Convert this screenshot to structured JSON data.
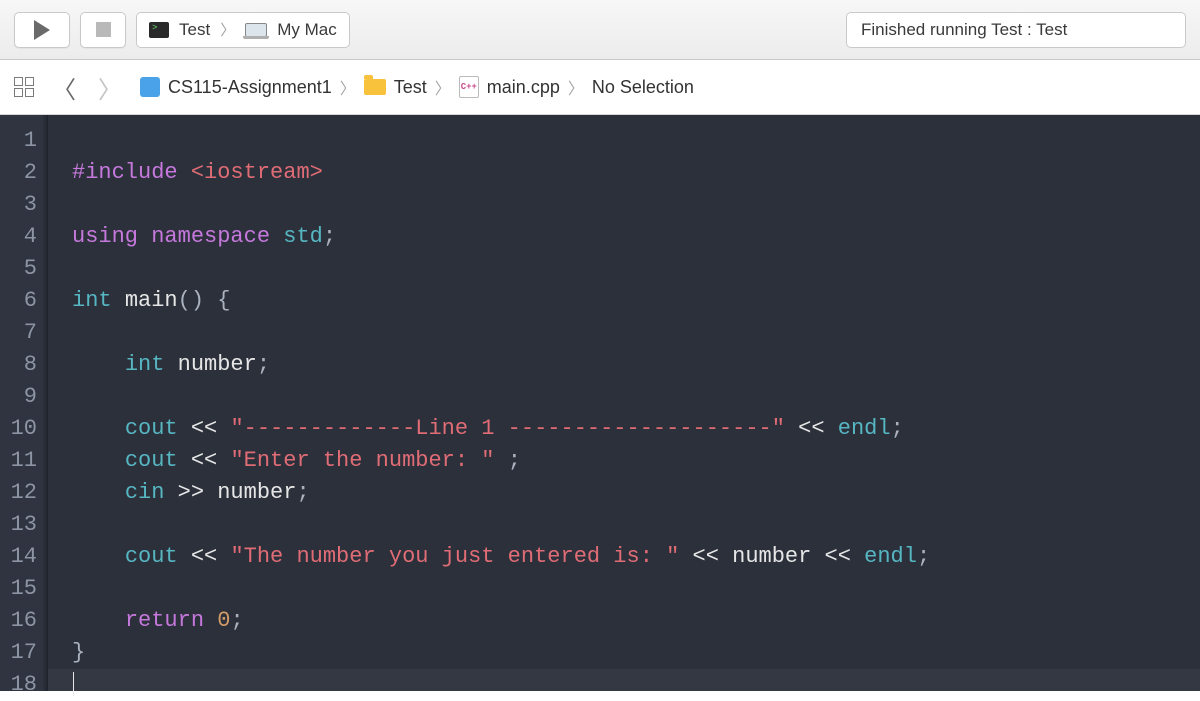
{
  "toolbar": {
    "scheme_target": "Test",
    "scheme_device": "My Mac",
    "activity_text": "Finished running Test : Test"
  },
  "breadcrumb": {
    "project": "CS115-Assignment1",
    "folder": "Test",
    "file": "main.cpp",
    "selection": "No Selection"
  },
  "code": {
    "line_numbers": [
      "1",
      "2",
      "3",
      "4",
      "5",
      "6",
      "7",
      "8",
      "9",
      "10",
      "11",
      "12",
      "13",
      "14",
      "15",
      "16",
      "17",
      "18"
    ],
    "l2_include": "#include",
    "l2_header": "<iostream>",
    "l4_using": "using",
    "l4_namespace": "namespace",
    "l4_std": "std",
    "l6_int": "int",
    "l6_main": "main",
    "l8_int": "int",
    "l8_number": "number",
    "l10_cout": "cout",
    "l10_str": "\"-------------Line 1 --------------------\"",
    "l10_endl": "endl",
    "l11_cout": "cout",
    "l11_str": "\"Enter the number: \"",
    "l12_cin": "cin",
    "l12_number": "number",
    "l14_cout": "cout",
    "l14_str": "\"The number you just entered is: \"",
    "l14_number": "number",
    "l14_endl": "endl",
    "l16_return": "return",
    "l16_zero": "0",
    "op_ll": "<<",
    "op_rr": ">>",
    "semi": ";",
    "lparen": "(",
    "rparen": ")",
    "lbrace": "{",
    "rbrace": "}"
  }
}
